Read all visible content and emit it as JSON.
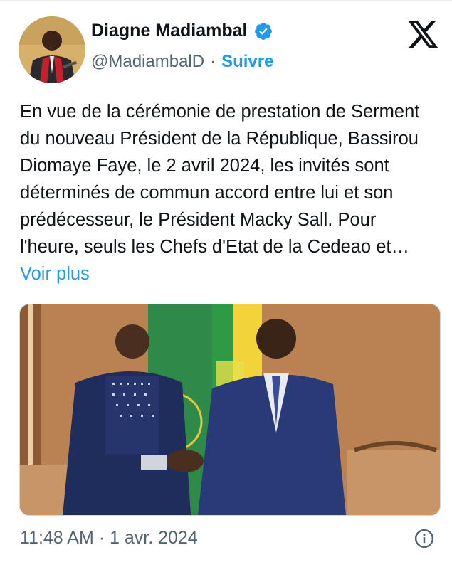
{
  "author": {
    "display_name": "Diagne Madiambal",
    "handle": "@MadiambalD",
    "separator": "·",
    "follow_label": "Suivre",
    "verified_color": "#1d9bf0"
  },
  "tweet": {
    "text": "En vue de la cérémonie de prestation de Serment du nouveau Président de la République, Bassirou Diomaye Faye, le 2 avril 2024, les invités sont déterminés de commun accord entre lui et son prédécesseur, le Président Macky Sall. Pour l'heure, seuls les Chefs d'Etat de la Cedeao et…",
    "more_label": "Voir plus",
    "timestamp": "11:48 AM · 1 avr. 2024"
  },
  "icons": {
    "platform": "x-logo-icon",
    "verified": "verified-badge-icon",
    "info": "info-icon"
  },
  "colors": {
    "accent": "#1d9bf0",
    "text": "#0f1419",
    "muted": "#536471"
  }
}
